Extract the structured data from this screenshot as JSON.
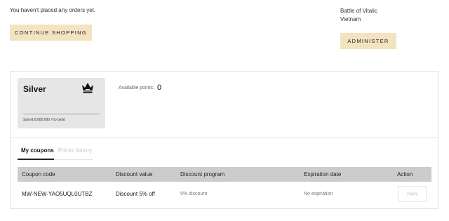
{
  "orders": {
    "empty_text": "You haven't placed any orders yet.",
    "continue_label": "CONTINUE SHOPPING"
  },
  "address": {
    "line1": "Battle of Vitalic",
    "line2": "Vietnam",
    "administer_label": "ADMINISTER"
  },
  "membership": {
    "tier": "Silver",
    "tier_icon": "crown-icon",
    "progress_to_next": 0.0,
    "spend_text": "Spend 8.000.000 ₫ to Gold",
    "points_label": "Available points:",
    "points_value": "0"
  },
  "tabs": [
    {
      "label": "My coupons",
      "active": true
    },
    {
      "label": "Points history",
      "active": false
    }
  ],
  "coupons": {
    "columns": [
      "Coupon code",
      "Discount value",
      "Discount program",
      "Expiration date",
      "Action"
    ],
    "rows": [
      {
        "code": "MW-NEW-YAO5UQL0UTBZ",
        "value": "Discount 5% off",
        "program": "5% discount",
        "expiration": "No expiration",
        "action": "Apply"
      }
    ]
  },
  "colors": {
    "button_bg": "#f4e3c1",
    "card_bg": "#e6e6e6",
    "header_bg": "#cccccc"
  }
}
